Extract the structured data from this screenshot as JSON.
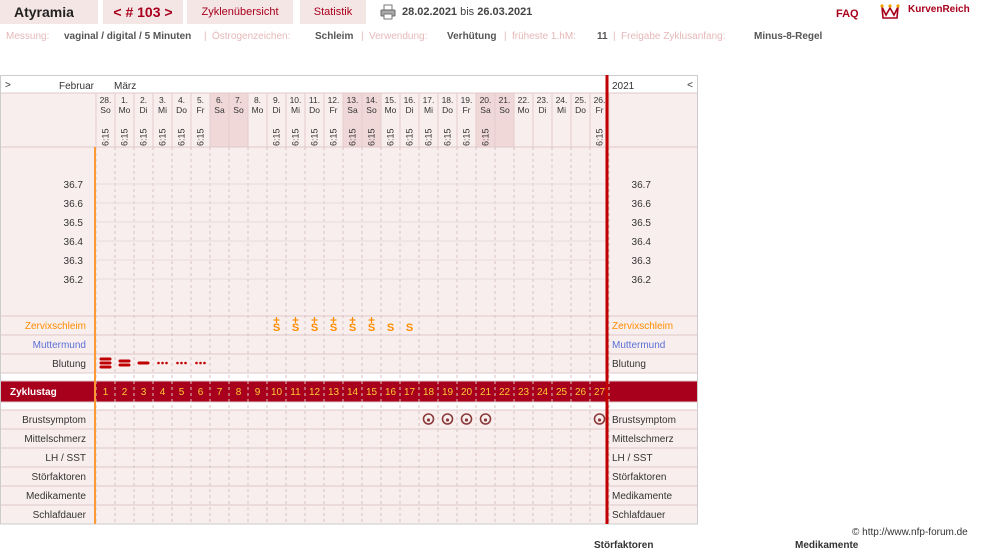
{
  "header": {
    "user": "Atyramia",
    "cycle": "< # 103 >",
    "overview": "Zyklenübersicht",
    "statistics": "Statistik",
    "date_start": "28.02.2021",
    "date_sep": "bis",
    "date_end": "26.03.2021",
    "faq": "FAQ",
    "brand": "KurvenReich"
  },
  "info": {
    "messung_label": "Messung:",
    "messung_value": "vaginal / digital / 5 Minuten",
    "oestrogen_label": "Östrogenzeichen:",
    "oestrogen_value": "Schleim",
    "verwendung_label": "Verwendung:",
    "verwendung_value": "Verhütung",
    "hm_label": "früheste 1.hM:",
    "hm_value": "11",
    "freigabe_label": "Freigabe Zyklusanfang:",
    "freigabe_value": "Minus-8-Regel"
  },
  "chart": {
    "nav_left": ">",
    "nav_right": "<",
    "month_prev": "Februar",
    "month_curr": "März",
    "year": "2021",
    "days": [
      {
        "n": "28.",
        "w": "So",
        "t": "6:15",
        "we": false
      },
      {
        "n": "1.",
        "w": "Mo",
        "t": "6:15",
        "we": false
      },
      {
        "n": "2.",
        "w": "Di",
        "t": "6:15",
        "we": false
      },
      {
        "n": "3.",
        "w": "Mi",
        "t": "6:15",
        "we": false
      },
      {
        "n": "4.",
        "w": "Do",
        "t": "6:15",
        "we": false
      },
      {
        "n": "5.",
        "w": "Fr",
        "t": "6:15",
        "we": false
      },
      {
        "n": "6.",
        "w": "Sa",
        "t": "",
        "we": true
      },
      {
        "n": "7.",
        "w": "So",
        "t": "",
        "we": true
      },
      {
        "n": "8.",
        "w": "Mo",
        "t": "",
        "we": false
      },
      {
        "n": "9.",
        "w": "Di",
        "t": "6:15",
        "we": false
      },
      {
        "n": "10.",
        "w": "Mi",
        "t": "6:15",
        "we": false
      },
      {
        "n": "11.",
        "w": "Do",
        "t": "6:15",
        "we": false
      },
      {
        "n": "12.",
        "w": "Fr",
        "t": "6:15",
        "we": false
      },
      {
        "n": "13.",
        "w": "Sa",
        "t": "6:15",
        "we": true
      },
      {
        "n": "14.",
        "w": "So",
        "t": "6:15",
        "we": true
      },
      {
        "n": "15.",
        "w": "Mo",
        "t": "6:15",
        "we": false
      },
      {
        "n": "16.",
        "w": "Di",
        "t": "6:15",
        "we": false
      },
      {
        "n": "17.",
        "w": "Mi",
        "t": "6:15",
        "we": false
      },
      {
        "n": "18.",
        "w": "Do",
        "t": "6:15",
        "we": false
      },
      {
        "n": "19.",
        "w": "Fr",
        "t": "6:15",
        "we": false
      },
      {
        "n": "20.",
        "w": "Sa",
        "t": "6:15",
        "we": true
      },
      {
        "n": "21.",
        "w": "So",
        "t": "",
        "we": true
      },
      {
        "n": "22.",
        "w": "Mo",
        "t": "",
        "we": false
      },
      {
        "n": "23.",
        "w": "Di",
        "t": "",
        "we": false
      },
      {
        "n": "24.",
        "w": "Mi",
        "t": "",
        "we": false
      },
      {
        "n": "25.",
        "w": "Do",
        "t": "",
        "we": false
      },
      {
        "n": "26.",
        "w": "Fr",
        "t": "6:15",
        "we": false
      }
    ],
    "temp_ticks": [
      "36.7",
      "36.6",
      "36.5",
      "36.4",
      "36.3",
      "36.2"
    ],
    "rows": {
      "zervix": "Zervixschleim",
      "muttermund": "Muttermund",
      "blutung": "Blutung",
      "zyklustag": "Zyklustag",
      "brust": "Brustsymptom",
      "mittel": "Mittelschmerz",
      "lh": "LH / SST",
      "stoer": "Störfaktoren",
      "medi": "Medikamente",
      "schlaf": "Schlafdauer"
    },
    "zervix_marks": [
      "",
      "",
      "",
      "",
      "",
      "",
      "",
      "",
      "",
      "S+",
      "S+",
      "S+",
      "S+",
      "S+",
      "S+",
      "S",
      "S",
      "",
      "",
      "",
      "",
      "",
      "",
      "",
      "",
      "",
      ""
    ],
    "blutung_marks": [
      "heavy",
      "medium",
      "light",
      "spot",
      "spot",
      "spot",
      "",
      "",
      "",
      "",
      "",
      "",
      "",
      "",
      "",
      "",
      "",
      "",
      "",
      "",
      "",
      "",
      "",
      "",
      "",
      "",
      ""
    ],
    "brust_marks": [
      false,
      false,
      false,
      false,
      false,
      false,
      false,
      false,
      false,
      false,
      false,
      false,
      false,
      false,
      false,
      false,
      false,
      true,
      true,
      true,
      true,
      false,
      false,
      false,
      false,
      false,
      true
    ],
    "cycle_days": [
      "1",
      "2",
      "3",
      "4",
      "5",
      "6",
      "7",
      "8",
      "9",
      "10",
      "11",
      "12",
      "13",
      "14",
      "15",
      "16",
      "17",
      "18",
      "19",
      "20",
      "21",
      "22",
      "23",
      "24",
      "25",
      "26",
      "27"
    ]
  },
  "footer": {
    "copyright": "© http://www.nfp-forum.de",
    "stoer_label": "Störfaktoren",
    "medi_label": "Medikamente"
  },
  "colors": {
    "accent": "#a8001c",
    "orange": "#ff8c00",
    "blue": "#5b6fd6",
    "pink_bg": "#f8eeee",
    "weekend_bg": "#f0d8d8"
  }
}
